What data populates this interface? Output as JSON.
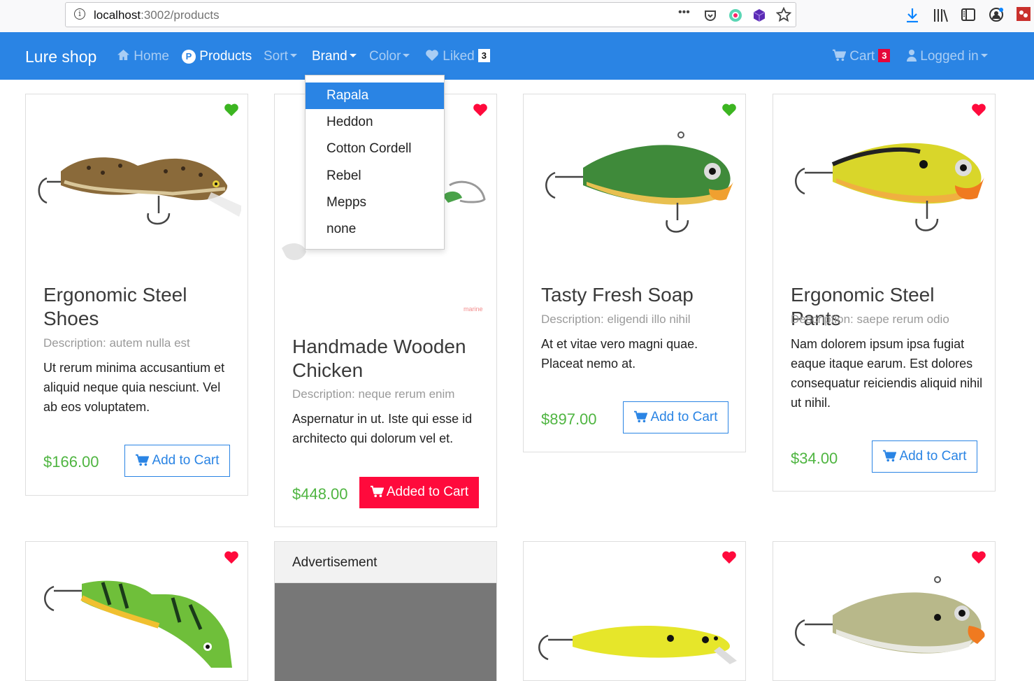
{
  "browser": {
    "url_host": "localhost",
    "url_path": ":3002/products",
    "menu_dots": "•••"
  },
  "nav": {
    "brand": "Lure shop",
    "home": "Home",
    "products": "Products",
    "products_icon_letter": "P",
    "sort": "Sort",
    "brand_menu": "Brand",
    "color": "Color",
    "liked": "Liked",
    "liked_count": "3",
    "cart": "Cart",
    "cart_count": "3",
    "logged_in": "Logged in"
  },
  "brand_dropdown": {
    "options": [
      "Rapala",
      "Heddon",
      "Cotton Cordell",
      "Rebel",
      "Mepps",
      "none"
    ],
    "active": "Rapala"
  },
  "products": [
    {
      "title": "Ergonomic Steel Shoes",
      "description": "Description: autem nulla est",
      "text": "Ut rerum minima accusantium et aliquid neque quia nesciunt. Vel ab eos voluptatem.",
      "price": "$166.00",
      "button": "Add to Cart",
      "heart_color": "#3cb521"
    },
    {
      "title": "Handmade Wooden Chicken",
      "description": "Description: neque rerum enim",
      "text": "Aspernatur in ut. Iste qui esse id architecto qui dolorum vel et.",
      "price": "$448.00",
      "button": "Added to Cart",
      "heart_color": "#ff0a3c"
    },
    {
      "title": "Tasty Fresh Soap",
      "description": "Description: eligendi illo nihil",
      "text": "At et vitae vero magni quae. Placeat nemo at.",
      "price": "$897.00",
      "button": "Add to Cart",
      "heart_color": "#3cb521"
    },
    {
      "title": "Ergonomic Steel Pants",
      "description": "Description: saepe rerum odio",
      "text": "Nam dolorem ipsum ipsa fugiat eaque itaque earum. Est dolores consequatur reiciendis aliquid nihil ut nihil.",
      "price": "$34.00",
      "button": "Add to Cart",
      "heart_color": "#ff0a3c"
    }
  ],
  "advertisement": {
    "label": "Advertisement"
  },
  "colors": {
    "primary": "#2a84e4",
    "price_green": "#4fb541",
    "added_red": "#ff0a3c"
  }
}
